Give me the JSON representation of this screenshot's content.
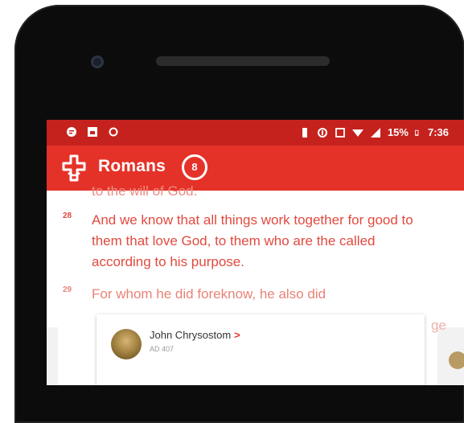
{
  "status_bar": {
    "battery_percent": "15%",
    "time": "7:36",
    "icons_left": [
      "message-icon",
      "gallery-icon",
      "sync-icon"
    ],
    "icons_right": [
      "vibrate-icon",
      "data-saver-icon",
      "nfc-icon",
      "wifi-icon",
      "signal-icon",
      "battery-icon"
    ]
  },
  "app_bar": {
    "title": "Romans",
    "chapter": "8",
    "logo_icon": "cross-logo-icon",
    "accent_color": "#e53229"
  },
  "verses": [
    {
      "number": "",
      "text": "to the will of God."
    },
    {
      "number": "28",
      "text": "And we know that all things work together for good to them that love God, to them who are the called according to his purpose."
    },
    {
      "number": "29",
      "text": "For whom he did foreknow, he also did"
    }
  ],
  "commentary": {
    "author": "John Chrysostom",
    "date": "AD 407",
    "chevron": ">",
    "partial_text": "ge"
  }
}
